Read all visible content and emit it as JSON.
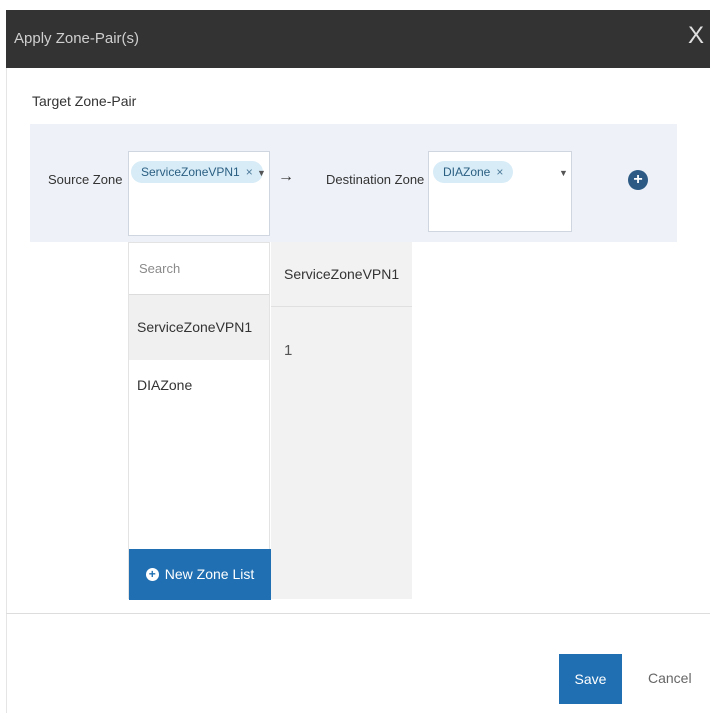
{
  "dialog": {
    "title": "Apply Zone-Pair(s)",
    "close_label": "X"
  },
  "target": {
    "section_title": "Target Zone-Pair",
    "source_label": "Source Zone",
    "source_selected": "ServiceZoneVPN1",
    "chip_remove": "×",
    "caret": "▼",
    "arrow": "→",
    "destination_label": "Destination Zone",
    "destination_selected": "DIAZone",
    "add_icon": "+"
  },
  "dropdown": {
    "search_placeholder": "Search",
    "options": [
      "ServiceZoneVPN1",
      "DIAZone"
    ],
    "new_zone_label": "New Zone List",
    "new_zone_icon": "+"
  },
  "detail_panel": {
    "header": "ServiceZoneVPN1",
    "count": "1"
  },
  "footer": {
    "save_label": "Save",
    "cancel_label": "Cancel"
  },
  "colors": {
    "titlebar": "#333333",
    "accent": "#1f6fb2",
    "band": "#eef2f8",
    "chip": "#d7ecf7"
  }
}
